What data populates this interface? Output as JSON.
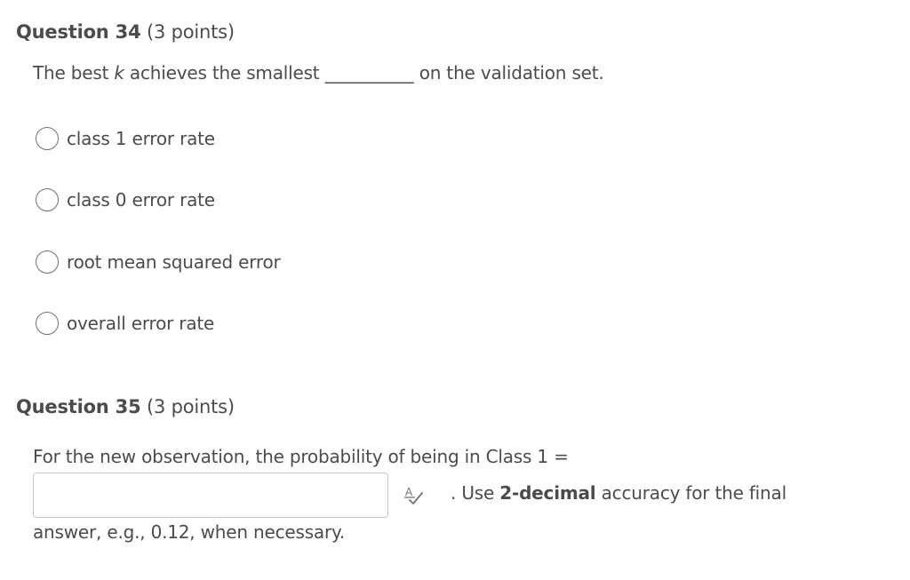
{
  "q34": {
    "number": "Question 34",
    "points": "(3 points)",
    "prompt_before": "The best ",
    "prompt_var": "k",
    "prompt_middle": " achieves the smallest ",
    "blank": "__________",
    "prompt_after": " on the validation set.",
    "options": [
      {
        "label": "class 1 error rate",
        "selected": false
      },
      {
        "label": "class 0 error rate",
        "selected": false
      },
      {
        "label": "root mean squared error",
        "selected": false
      },
      {
        "label": "overall error rate",
        "selected": false
      }
    ]
  },
  "q35": {
    "number": "Question 35",
    "points": "(3 points)",
    "prompt": "For the new observation, the probability of being in Class 1 =",
    "answer_value": "",
    "after_input_pre": ". Use ",
    "after_input_bold": "2-decimal",
    "after_input_post": " accuracy for the final",
    "tail": "answer, e.g., 0.12, when necessary.",
    "spellcheck_icon": "spellcheck-icon"
  }
}
